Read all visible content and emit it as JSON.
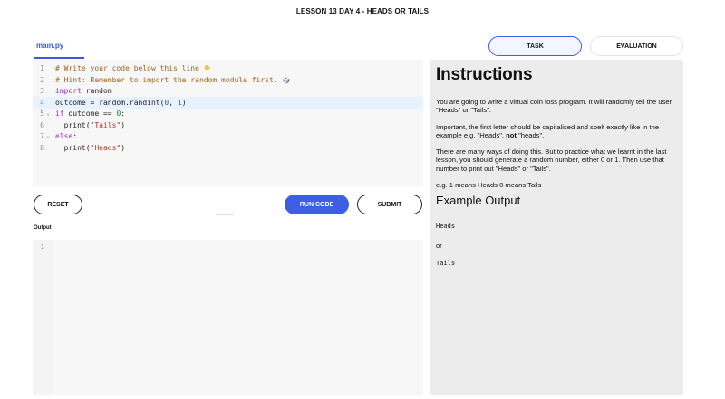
{
  "header": {
    "title": "LESSON 13 DAY 4 - HEADS OR TAILS"
  },
  "editor": {
    "file_tab": "main.py",
    "lines": [
      {
        "num": "1",
        "fold": "",
        "parts": [
          {
            "cls": "c-comment",
            "text": "# Write your code below this line "
          },
          {
            "cls": "emoji",
            "text": "👇"
          }
        ]
      },
      {
        "num": "2",
        "fold": "",
        "parts": [
          {
            "cls": "c-comment",
            "text": "# Hint: Remember to import the random module first. "
          },
          {
            "cls": "emoji",
            "text": "🎲"
          }
        ]
      },
      {
        "num": "3",
        "fold": "",
        "parts": [
          {
            "cls": "c-kw",
            "text": "import"
          },
          {
            "cls": "c-plain",
            "text": " random"
          }
        ]
      },
      {
        "num": "4",
        "fold": "",
        "active": true,
        "parts": [
          {
            "cls": "c-plain",
            "text": "outcome = random.randint("
          },
          {
            "cls": "c-num",
            "text": "0"
          },
          {
            "cls": "c-plain",
            "text": ", "
          },
          {
            "cls": "c-num",
            "text": "1"
          },
          {
            "cls": "c-plain",
            "text": ")"
          }
        ]
      },
      {
        "num": "5",
        "fold": "⌄",
        "parts": [
          {
            "cls": "c-kw",
            "text": "if"
          },
          {
            "cls": "c-plain",
            "text": " outcome == "
          },
          {
            "cls": "c-num",
            "text": "0"
          },
          {
            "cls": "c-plain",
            "text": ":"
          }
        ]
      },
      {
        "num": "6",
        "fold": "",
        "parts": [
          {
            "cls": "c-plain",
            "text": "  print("
          },
          {
            "cls": "c-str",
            "text": "\"Tails\""
          },
          {
            "cls": "c-plain",
            "text": ")"
          }
        ]
      },
      {
        "num": "7",
        "fold": "⌄",
        "parts": [
          {
            "cls": "c-kw",
            "text": "else"
          },
          {
            "cls": "c-plain",
            "text": ":"
          }
        ]
      },
      {
        "num": "8",
        "fold": "",
        "parts": [
          {
            "cls": "c-plain",
            "text": "  print("
          },
          {
            "cls": "c-str",
            "text": "\"Heads\""
          },
          {
            "cls": "c-plain",
            "text": ")"
          }
        ]
      }
    ]
  },
  "buttons": {
    "reset": "RESET",
    "run": "RUN CODE",
    "submit": "SUBMIT"
  },
  "output": {
    "label": "Output",
    "line_number": "1"
  },
  "tabs": {
    "task": "TASK",
    "evaluation": "EVALUATION",
    "active": "task"
  },
  "instructions": {
    "title": "Instructions",
    "p1": "You are going to write a virtual coin toss program. It will randomly tell the user \"Heads\" or \"Tails\".",
    "p2_before": "Important, the first letter should be capitalised and spelt exactly like in the example e.g. \"Heads\", ",
    "p2_bold": "not",
    "p2_after": " \"heads\".",
    "p3": "There are many ways of doing this. But to practice what we learnt in the last lesson, you should generate a random number, either 0 or 1. Then use that number to print out \"Heads\" or \"Tails\".",
    "p4": "e.g. 1 means Heads 0 means Tails",
    "example_heading": "Example Output",
    "example_out1": "Heads",
    "example_or": "or",
    "example_out2": "Tails"
  },
  "colors": {
    "accent": "#3c5fe6",
    "panel_bg": "#ececec",
    "editor_bg": "#f7f7f7"
  }
}
